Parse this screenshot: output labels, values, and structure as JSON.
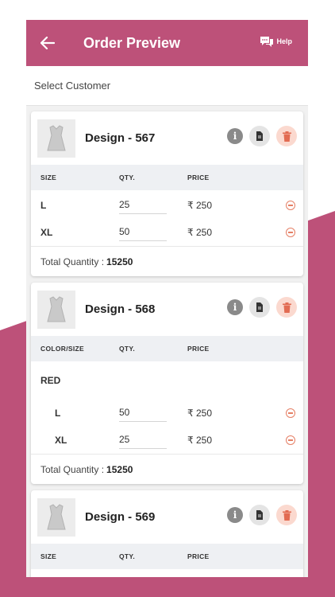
{
  "colors": {
    "accent": "#bd5179",
    "delete_bg": "#fbd9cf",
    "delete_fg": "#e26b52"
  },
  "appbar": {
    "title": "Order Preview",
    "help_label": "Help"
  },
  "customer": {
    "placeholder": "Select Customer"
  },
  "cards": [
    {
      "name": "Design - 567",
      "header": {
        "c1": "SIZE",
        "c2": "QTY.",
        "c3": "PRICE"
      },
      "rows": [
        {
          "size": "L",
          "qty": "25",
          "price": "₹ 250"
        },
        {
          "size": "XL",
          "qty": "50",
          "price": "₹ 250"
        }
      ],
      "total_label": "Total Quantity :",
      "total_value": "15250"
    },
    {
      "name": "Design - 568",
      "header": {
        "c1": "COLOR/SIZE",
        "c2": "QTY.",
        "c3": "PRICE"
      },
      "color": "RED",
      "rows": [
        {
          "size": "L",
          "qty": "50",
          "price": "₹ 250"
        },
        {
          "size": "XL",
          "qty": "25",
          "price": "₹ 250"
        }
      ],
      "total_label": "Total Quantity :",
      "total_value": "15250"
    },
    {
      "name": "Design - 569",
      "header": {
        "c1": "SIZE",
        "c2": "QTY.",
        "c3": "PRICE"
      }
    }
  ]
}
